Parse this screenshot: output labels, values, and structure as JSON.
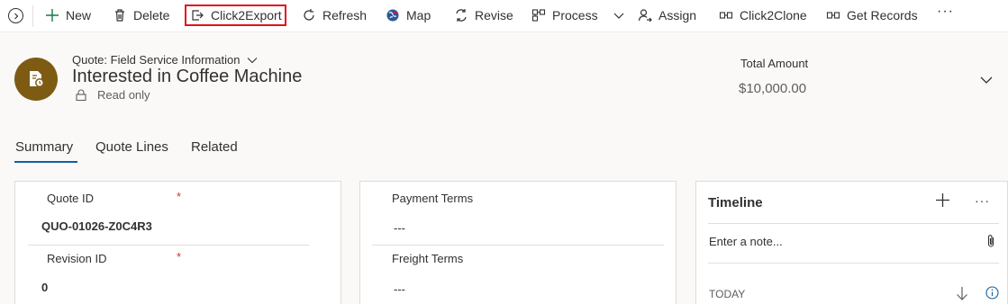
{
  "commandbar": {
    "items": [
      {
        "label": "New",
        "icon": "plus-icon"
      },
      {
        "label": "Delete",
        "icon": "trash-icon"
      },
      {
        "label": "Click2Export",
        "icon": "export-icon"
      },
      {
        "label": "Refresh",
        "icon": "refresh-icon"
      },
      {
        "label": "Map",
        "icon": "globe-map-icon"
      },
      {
        "label": "Revise",
        "icon": "revise-icon"
      },
      {
        "label": "Process",
        "icon": "process-icon"
      },
      {
        "label": "Assign",
        "icon": "assign-person-icon"
      },
      {
        "label": "Click2Clone",
        "icon": "clone-icon"
      },
      {
        "label": "Get Records",
        "icon": "get-records-icon"
      }
    ],
    "more": "···",
    "highlight_color": "#e0141e"
  },
  "header": {
    "entity_form": "Quote: Field Service Information",
    "title": "Interested in Coffee Machine",
    "status": "Read only",
    "total_amount_label": "Total Amount",
    "total_amount_value": "$10,000.00",
    "avatar_color": "#7d5b13"
  },
  "tabs": [
    {
      "label": "Summary",
      "selected": true
    },
    {
      "label": "Quote Lines",
      "selected": false
    },
    {
      "label": "Related",
      "selected": false
    }
  ],
  "section1": {
    "fields": [
      {
        "label": "Quote ID",
        "required": "*",
        "value": "QUO-01026-Z0C4R3"
      },
      {
        "label": "Revision ID",
        "required": "*",
        "value": "0"
      }
    ]
  },
  "section2": {
    "fields": [
      {
        "label": "Payment Terms",
        "value": "---"
      },
      {
        "label": "Freight Terms",
        "value": "---"
      }
    ]
  },
  "timeline": {
    "title": "Timeline",
    "more": "···",
    "note_placeholder": "Enter a note...",
    "group_label": "TODAY"
  }
}
